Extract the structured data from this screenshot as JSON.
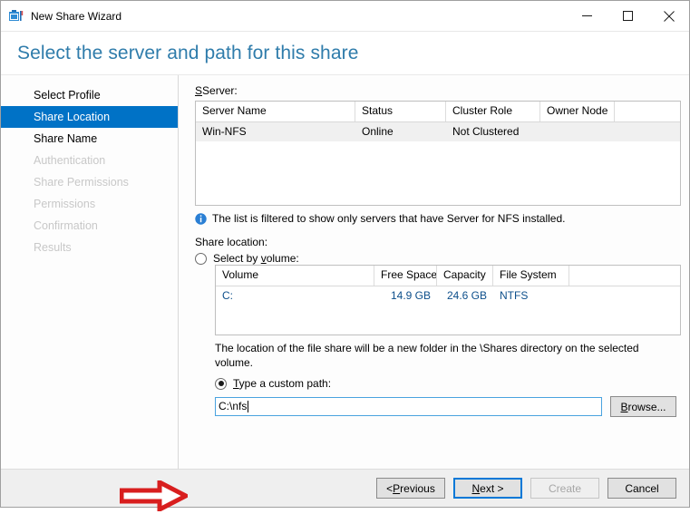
{
  "window": {
    "title": "New Share Wizard",
    "icon": "share-folder-icon",
    "minimize_label": "Minimize",
    "maximize_label": "Maximize",
    "close_label": "Close"
  },
  "header": {
    "title": "Select the server and path for this share",
    "accent_color": "#2f7cab"
  },
  "sidebar": {
    "selected_color": "#0072c6",
    "items": [
      {
        "label": "Select Profile",
        "state": "enabled"
      },
      {
        "label": "Share Location",
        "state": "selected"
      },
      {
        "label": "Share Name",
        "state": "enabled"
      },
      {
        "label": "Authentication",
        "state": "disabled"
      },
      {
        "label": "Share Permissions",
        "state": "disabled"
      },
      {
        "label": "Permissions",
        "state": "disabled"
      },
      {
        "label": "Confirmation",
        "state": "disabled"
      },
      {
        "label": "Results",
        "state": "disabled"
      }
    ]
  },
  "server_section": {
    "label": "Server:",
    "columns": [
      "Server Name",
      "Status",
      "Cluster Role",
      "Owner Node"
    ],
    "rows": [
      {
        "server_name": "Win-NFS",
        "status": "Online",
        "cluster_role": "Not Clustered",
        "owner_node": "",
        "selected": true
      }
    ],
    "info_icon": "info-icon",
    "info_text": "The list is filtered to show only servers that have Server for NFS installed."
  },
  "share_location_section": {
    "label": "Share location:",
    "select_by_volume": {
      "label": "Select by volume:",
      "checked": false
    },
    "volume_columns": [
      "Volume",
      "Free Space",
      "Capacity",
      "File System"
    ],
    "volume_rows": [
      {
        "volume": "C:",
        "free_space": "14.9 GB",
        "capacity": "24.6 GB",
        "file_system": "NTFS"
      }
    ],
    "description": "The location of the file share will be a new folder in the \\Shares directory on the selected volume.",
    "custom_path": {
      "label": "Type a custom path:",
      "checked": true,
      "value": "C:\\nfs",
      "placeholder": "",
      "browse_label": "Browse..."
    }
  },
  "annotation": {
    "arrow": "red-right-arrow",
    "color": "#d81e1e"
  },
  "footer": {
    "previous_label": "< Previous",
    "next_label": "Next >",
    "create_label": "Create",
    "cancel_label": "Cancel",
    "next_is_default": true,
    "create_disabled": true
  }
}
